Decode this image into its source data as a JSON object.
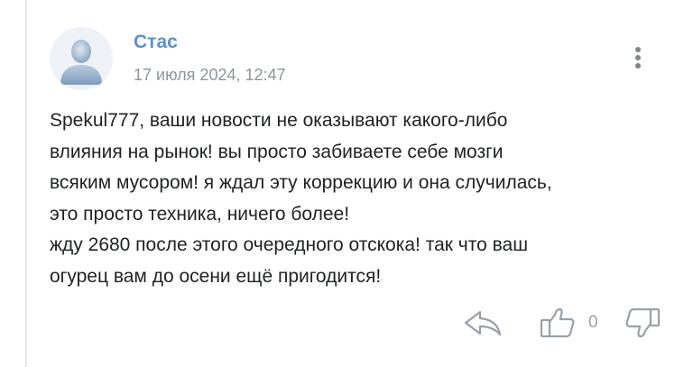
{
  "comment": {
    "author": "Стас",
    "timestamp": "17 июля 2024, 12:47",
    "lines": [
      "Spekul777, ваши новости не оказывают какого-либо",
      "влияния на рынок! вы просто забиваете себе мозги",
      "всяким мусором! я ждал эту коррекцию и она случилась,",
      "это просто техника, ничего более!",
      "жду 2680 после этого очередного отскока! так что ваш",
      "огурец вам до осени ещё пригодится!"
    ],
    "like_count": "0"
  },
  "icons": {
    "avatar": "user-silhouette-icon",
    "menu": "more-vertical-icon",
    "reply": "reply-arrow-icon",
    "like": "thumbs-up-icon",
    "dislike": "thumbs-down-icon"
  },
  "colors": {
    "author": "#5b93c8",
    "timestamp": "#8e949c",
    "text": "#1f2124",
    "icon": "#9aa0a6",
    "avatar_figure": "#9fb5cf"
  }
}
